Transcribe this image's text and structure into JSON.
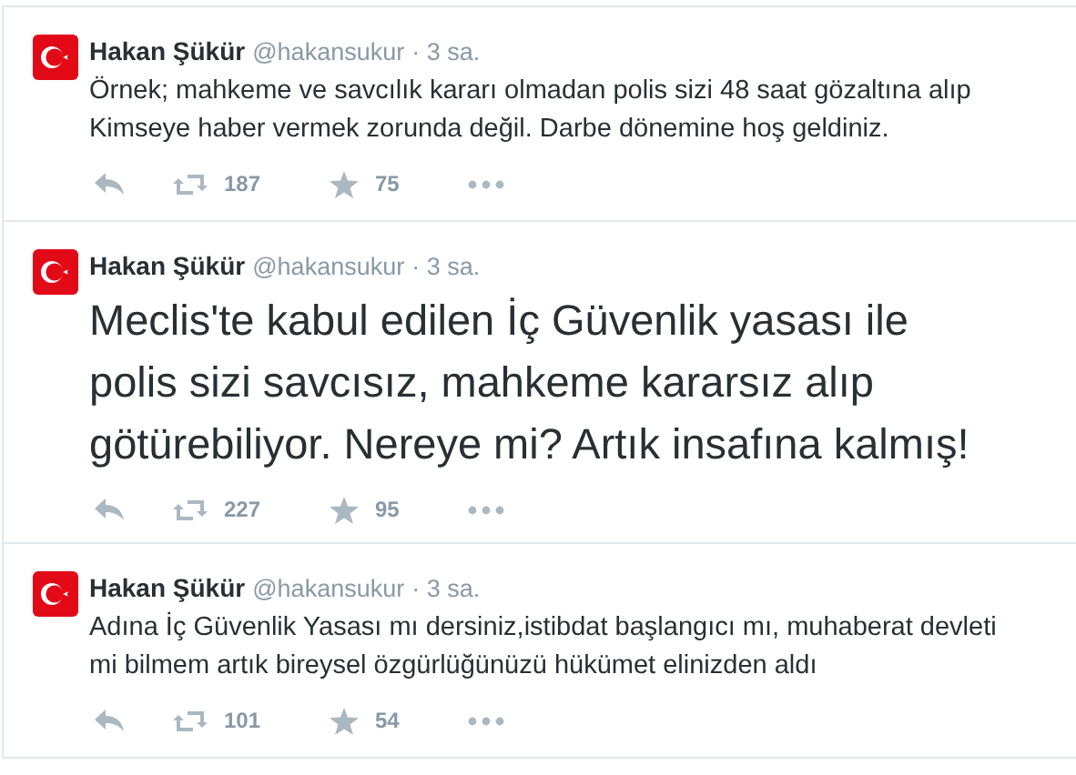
{
  "tweets": [
    {
      "kind": "normal",
      "name": "Hakan Şükür",
      "handle": "@hakansukur",
      "time": "· 3 sa.",
      "text": "Örnek; mahkeme ve savcılık kararı olmadan polis sizi 48 saat gözaltına alıp Kimseye haber vermek zorunda değil. Darbe dönemine hoş geldiniz.",
      "retweets": "187",
      "likes": "75"
    },
    {
      "kind": "large",
      "name": "Hakan Şükür",
      "handle": "@hakansukur",
      "time": "· 3 sa.",
      "text": "Meclis'te kabul edilen İç Güvenlik yasası ile polis sizi savcısız, mahkeme kararsız alıp götürebiliyor. Nereye mi? Artık insafına kalmış!",
      "retweets": "227",
      "likes": "95"
    },
    {
      "kind": "normal",
      "name": "Hakan Şükür",
      "handle": "@hakansukur",
      "time": "· 3 sa.",
      "text": "Adına İç Güvenlik Yasası mı dersiniz,istibdat başlangıcı mı, muhaberat devleti mi bilmem artık bireysel özgürlüğünüzü hükümet elinizden aldı",
      "retweets": "101",
      "likes": "54"
    }
  ]
}
